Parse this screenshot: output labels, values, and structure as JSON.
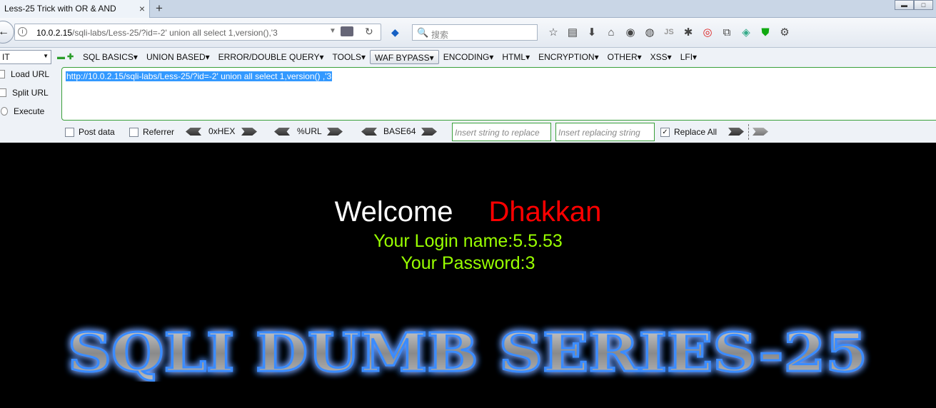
{
  "browser": {
    "tab_title": "Less-25 Trick with OR & AND",
    "tab_close": "×",
    "new_tab": "+",
    "url_host": "10.0.2.15",
    "url_path": "/sqli-labs/Less-25/?id=-2' union all select 1,version(),'3",
    "search_placeholder": "搜索",
    "toolbar_icons": [
      "bookmark-star-icon",
      "reading-list-icon",
      "download-icon",
      "home-icon",
      "globe-icon",
      "palette-icon",
      "js-icon",
      "bug-icon",
      "target-icon",
      "extension-icon",
      "map-icon",
      "shield-icon",
      "gear-icon"
    ],
    "js_label": "JS"
  },
  "hackbar": {
    "select_value": "IT",
    "menus": [
      "SQL BASICS▾",
      "UNION BASED▾",
      "ERROR/DOUBLE QUERY▾",
      "TOOLS▾",
      "WAF BYPASS▾",
      "ENCODING▾",
      "HTML▾",
      "ENCRYPTION▾",
      "OTHER▾",
      "XSS▾",
      "LFI▾"
    ],
    "buttons": {
      "load": "Load URL",
      "split": "Split URL",
      "execute": "Execute"
    },
    "url_text": "http://10.0.2.15/sqli-labs/Less-25/?id=-2' union all select 1,version() ,'3",
    "post_data": "Post data",
    "referrer": "Referrer",
    "hex": "0xHEX",
    "url_enc": "%URL",
    "base64": "BASE64",
    "replace_placeholder": "Insert string to replace",
    "replacing_placeholder": "Insert replacing string",
    "replace_all": "Replace All",
    "replace_all_checked": "✓"
  },
  "page": {
    "welcome": "Welcome",
    "user": "Dhakkan",
    "login_line": "Your Login name:5.5.53",
    "password_line": "Your Password:3",
    "banner": "SQLI DUMB SERIES-25"
  }
}
